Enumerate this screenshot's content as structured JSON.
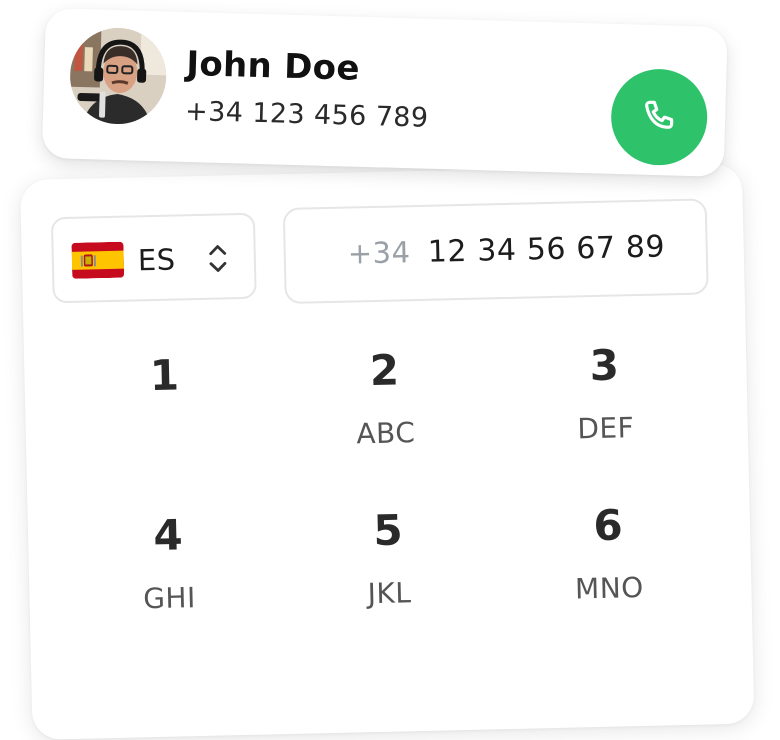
{
  "contact": {
    "name": "John Doe",
    "phone": "+34 123 456 789",
    "avatar_icon": "person-with-headphones-avatar",
    "call_icon": "phone-icon",
    "call_color": "#2ec36b"
  },
  "country": {
    "code": "ES",
    "flag_icon": "spain-flag-icon",
    "selector_icon": "chevron-up-down-icon"
  },
  "number_input": {
    "prefix": "+34",
    "value": "12 34 56 67 89"
  },
  "keypad": [
    {
      "digit": "1",
      "letters": ""
    },
    {
      "digit": "2",
      "letters": "ABC"
    },
    {
      "digit": "3",
      "letters": "DEF"
    },
    {
      "digit": "4",
      "letters": "GHI"
    },
    {
      "digit": "5",
      "letters": "JKL"
    },
    {
      "digit": "6",
      "letters": "MNO"
    }
  ]
}
